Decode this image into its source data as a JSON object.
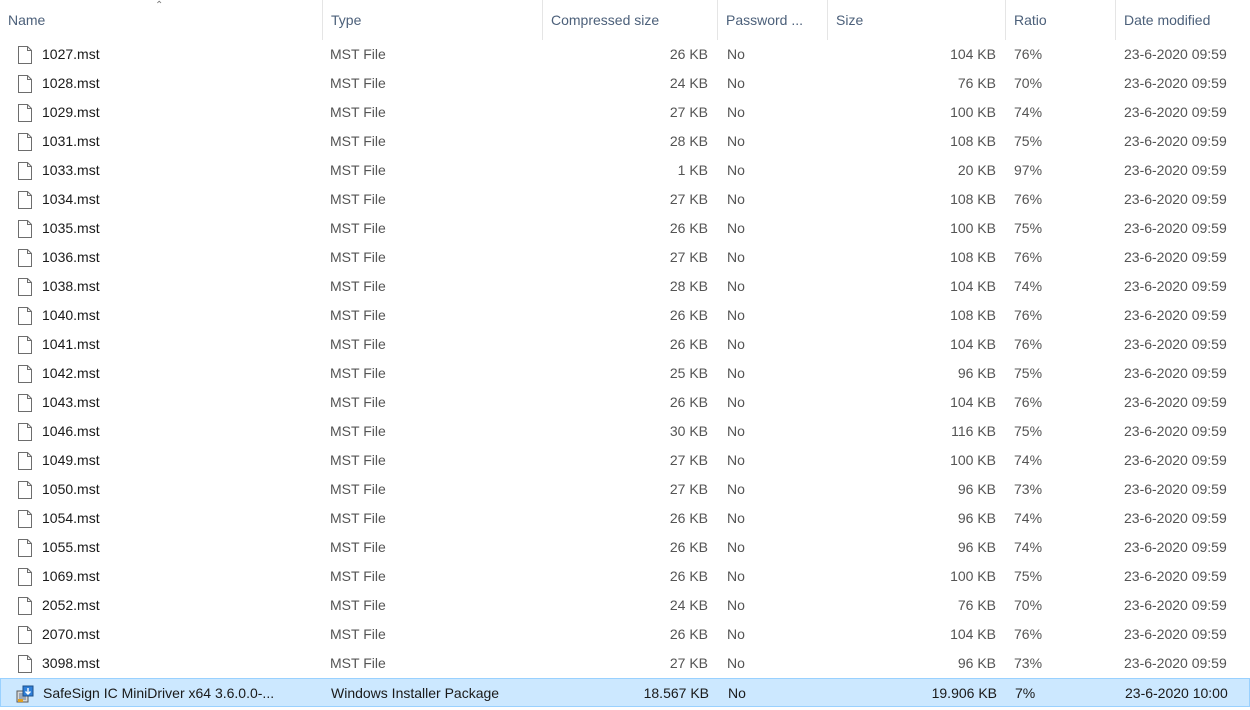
{
  "columns": {
    "name": "Name",
    "type": "Type",
    "compressed_size": "Compressed size",
    "password": "Password ...",
    "size": "Size",
    "ratio": "Ratio",
    "date_modified": "Date modified"
  },
  "icons": {
    "sort": "chevron-up-icon",
    "file": "file-icon",
    "installer": "installer-package-icon"
  },
  "colors": {
    "selection_bg": "#cce8ff",
    "selection_border": "#99d1ff",
    "header_text": "#4c607a"
  },
  "files": [
    {
      "name": "1027.mst",
      "type": "MST File",
      "compressed": "26 KB",
      "password": "No",
      "size": "104 KB",
      "ratio": "76%",
      "date": "23-6-2020 09:59",
      "icon": "file-icon",
      "selected": false
    },
    {
      "name": "1028.mst",
      "type": "MST File",
      "compressed": "24 KB",
      "password": "No",
      "size": "76 KB",
      "ratio": "70%",
      "date": "23-6-2020 09:59",
      "icon": "file-icon",
      "selected": false
    },
    {
      "name": "1029.mst",
      "type": "MST File",
      "compressed": "27 KB",
      "password": "No",
      "size": "100 KB",
      "ratio": "74%",
      "date": "23-6-2020 09:59",
      "icon": "file-icon",
      "selected": false
    },
    {
      "name": "1031.mst",
      "type": "MST File",
      "compressed": "28 KB",
      "password": "No",
      "size": "108 KB",
      "ratio": "75%",
      "date": "23-6-2020 09:59",
      "icon": "file-icon",
      "selected": false
    },
    {
      "name": "1033.mst",
      "type": "MST File",
      "compressed": "1 KB",
      "password": "No",
      "size": "20 KB",
      "ratio": "97%",
      "date": "23-6-2020 09:59",
      "icon": "file-icon",
      "selected": false
    },
    {
      "name": "1034.mst",
      "type": "MST File",
      "compressed": "27 KB",
      "password": "No",
      "size": "108 KB",
      "ratio": "76%",
      "date": "23-6-2020 09:59",
      "icon": "file-icon",
      "selected": false
    },
    {
      "name": "1035.mst",
      "type": "MST File",
      "compressed": "26 KB",
      "password": "No",
      "size": "100 KB",
      "ratio": "75%",
      "date": "23-6-2020 09:59",
      "icon": "file-icon",
      "selected": false
    },
    {
      "name": "1036.mst",
      "type": "MST File",
      "compressed": "27 KB",
      "password": "No",
      "size": "108 KB",
      "ratio": "76%",
      "date": "23-6-2020 09:59",
      "icon": "file-icon",
      "selected": false
    },
    {
      "name": "1038.mst",
      "type": "MST File",
      "compressed": "28 KB",
      "password": "No",
      "size": "104 KB",
      "ratio": "74%",
      "date": "23-6-2020 09:59",
      "icon": "file-icon",
      "selected": false
    },
    {
      "name": "1040.mst",
      "type": "MST File",
      "compressed": "26 KB",
      "password": "No",
      "size": "108 KB",
      "ratio": "76%",
      "date": "23-6-2020 09:59",
      "icon": "file-icon",
      "selected": false
    },
    {
      "name": "1041.mst",
      "type": "MST File",
      "compressed": "26 KB",
      "password": "No",
      "size": "104 KB",
      "ratio": "76%",
      "date": "23-6-2020 09:59",
      "icon": "file-icon",
      "selected": false
    },
    {
      "name": "1042.mst",
      "type": "MST File",
      "compressed": "25 KB",
      "password": "No",
      "size": "96 KB",
      "ratio": "75%",
      "date": "23-6-2020 09:59",
      "icon": "file-icon",
      "selected": false
    },
    {
      "name": "1043.mst",
      "type": "MST File",
      "compressed": "26 KB",
      "password": "No",
      "size": "104 KB",
      "ratio": "76%",
      "date": "23-6-2020 09:59",
      "icon": "file-icon",
      "selected": false
    },
    {
      "name": "1046.mst",
      "type": "MST File",
      "compressed": "30 KB",
      "password": "No",
      "size": "116 KB",
      "ratio": "75%",
      "date": "23-6-2020 09:59",
      "icon": "file-icon",
      "selected": false
    },
    {
      "name": "1049.mst",
      "type": "MST File",
      "compressed": "27 KB",
      "password": "No",
      "size": "100 KB",
      "ratio": "74%",
      "date": "23-6-2020 09:59",
      "icon": "file-icon",
      "selected": false
    },
    {
      "name": "1050.mst",
      "type": "MST File",
      "compressed": "27 KB",
      "password": "No",
      "size": "96 KB",
      "ratio": "73%",
      "date": "23-6-2020 09:59",
      "icon": "file-icon",
      "selected": false
    },
    {
      "name": "1054.mst",
      "type": "MST File",
      "compressed": "26 KB",
      "password": "No",
      "size": "96 KB",
      "ratio": "74%",
      "date": "23-6-2020 09:59",
      "icon": "file-icon",
      "selected": false
    },
    {
      "name": "1055.mst",
      "type": "MST File",
      "compressed": "26 KB",
      "password": "No",
      "size": "96 KB",
      "ratio": "74%",
      "date": "23-6-2020 09:59",
      "icon": "file-icon",
      "selected": false
    },
    {
      "name": "1069.mst",
      "type": "MST File",
      "compressed": "26 KB",
      "password": "No",
      "size": "100 KB",
      "ratio": "75%",
      "date": "23-6-2020 09:59",
      "icon": "file-icon",
      "selected": false
    },
    {
      "name": "2052.mst",
      "type": "MST File",
      "compressed": "24 KB",
      "password": "No",
      "size": "76 KB",
      "ratio": "70%",
      "date": "23-6-2020 09:59",
      "icon": "file-icon",
      "selected": false
    },
    {
      "name": "2070.mst",
      "type": "MST File",
      "compressed": "26 KB",
      "password": "No",
      "size": "104 KB",
      "ratio": "76%",
      "date": "23-6-2020 09:59",
      "icon": "file-icon",
      "selected": false
    },
    {
      "name": "3098.mst",
      "type": "MST File",
      "compressed": "27 KB",
      "password": "No",
      "size": "96 KB",
      "ratio": "73%",
      "date": "23-6-2020 09:59",
      "icon": "file-icon",
      "selected": false
    },
    {
      "name": "SafeSign IC MiniDriver x64 3.6.0.0-...",
      "type": "Windows Installer Package",
      "compressed": "18.567 KB",
      "password": "No",
      "size": "19.906 KB",
      "ratio": "7%",
      "date": "23-6-2020 10:00",
      "icon": "installer-package-icon",
      "selected": true
    }
  ]
}
